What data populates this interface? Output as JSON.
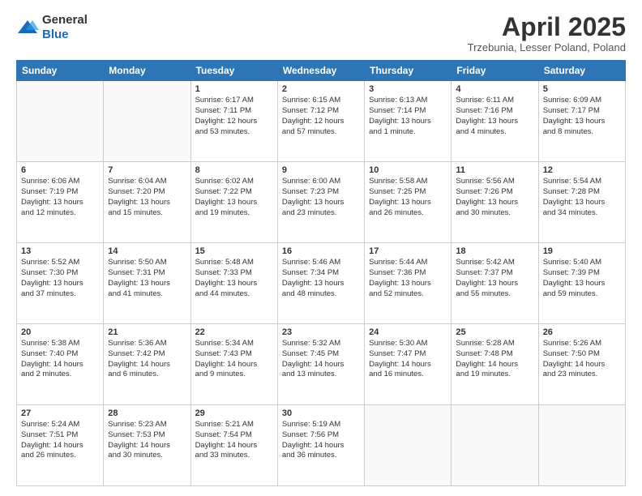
{
  "header": {
    "logo_general": "General",
    "logo_blue": "Blue",
    "month": "April 2025",
    "location": "Trzebunia, Lesser Poland, Poland"
  },
  "days_of_week": [
    "Sunday",
    "Monday",
    "Tuesday",
    "Wednesday",
    "Thursday",
    "Friday",
    "Saturday"
  ],
  "weeks": [
    [
      {
        "day": "",
        "info": ""
      },
      {
        "day": "",
        "info": ""
      },
      {
        "day": "1",
        "info": "Sunrise: 6:17 AM\nSunset: 7:11 PM\nDaylight: 12 hours\nand 53 minutes."
      },
      {
        "day": "2",
        "info": "Sunrise: 6:15 AM\nSunset: 7:12 PM\nDaylight: 12 hours\nand 57 minutes."
      },
      {
        "day": "3",
        "info": "Sunrise: 6:13 AM\nSunset: 7:14 PM\nDaylight: 13 hours\nand 1 minute."
      },
      {
        "day": "4",
        "info": "Sunrise: 6:11 AM\nSunset: 7:16 PM\nDaylight: 13 hours\nand 4 minutes."
      },
      {
        "day": "5",
        "info": "Sunrise: 6:09 AM\nSunset: 7:17 PM\nDaylight: 13 hours\nand 8 minutes."
      }
    ],
    [
      {
        "day": "6",
        "info": "Sunrise: 6:06 AM\nSunset: 7:19 PM\nDaylight: 13 hours\nand 12 minutes."
      },
      {
        "day": "7",
        "info": "Sunrise: 6:04 AM\nSunset: 7:20 PM\nDaylight: 13 hours\nand 15 minutes."
      },
      {
        "day": "8",
        "info": "Sunrise: 6:02 AM\nSunset: 7:22 PM\nDaylight: 13 hours\nand 19 minutes."
      },
      {
        "day": "9",
        "info": "Sunrise: 6:00 AM\nSunset: 7:23 PM\nDaylight: 13 hours\nand 23 minutes."
      },
      {
        "day": "10",
        "info": "Sunrise: 5:58 AM\nSunset: 7:25 PM\nDaylight: 13 hours\nand 26 minutes."
      },
      {
        "day": "11",
        "info": "Sunrise: 5:56 AM\nSunset: 7:26 PM\nDaylight: 13 hours\nand 30 minutes."
      },
      {
        "day": "12",
        "info": "Sunrise: 5:54 AM\nSunset: 7:28 PM\nDaylight: 13 hours\nand 34 minutes."
      }
    ],
    [
      {
        "day": "13",
        "info": "Sunrise: 5:52 AM\nSunset: 7:30 PM\nDaylight: 13 hours\nand 37 minutes."
      },
      {
        "day": "14",
        "info": "Sunrise: 5:50 AM\nSunset: 7:31 PM\nDaylight: 13 hours\nand 41 minutes."
      },
      {
        "day": "15",
        "info": "Sunrise: 5:48 AM\nSunset: 7:33 PM\nDaylight: 13 hours\nand 44 minutes."
      },
      {
        "day": "16",
        "info": "Sunrise: 5:46 AM\nSunset: 7:34 PM\nDaylight: 13 hours\nand 48 minutes."
      },
      {
        "day": "17",
        "info": "Sunrise: 5:44 AM\nSunset: 7:36 PM\nDaylight: 13 hours\nand 52 minutes."
      },
      {
        "day": "18",
        "info": "Sunrise: 5:42 AM\nSunset: 7:37 PM\nDaylight: 13 hours\nand 55 minutes."
      },
      {
        "day": "19",
        "info": "Sunrise: 5:40 AM\nSunset: 7:39 PM\nDaylight: 13 hours\nand 59 minutes."
      }
    ],
    [
      {
        "day": "20",
        "info": "Sunrise: 5:38 AM\nSunset: 7:40 PM\nDaylight: 14 hours\nand 2 minutes."
      },
      {
        "day": "21",
        "info": "Sunrise: 5:36 AM\nSunset: 7:42 PM\nDaylight: 14 hours\nand 6 minutes."
      },
      {
        "day": "22",
        "info": "Sunrise: 5:34 AM\nSunset: 7:43 PM\nDaylight: 14 hours\nand 9 minutes."
      },
      {
        "day": "23",
        "info": "Sunrise: 5:32 AM\nSunset: 7:45 PM\nDaylight: 14 hours\nand 13 minutes."
      },
      {
        "day": "24",
        "info": "Sunrise: 5:30 AM\nSunset: 7:47 PM\nDaylight: 14 hours\nand 16 minutes."
      },
      {
        "day": "25",
        "info": "Sunrise: 5:28 AM\nSunset: 7:48 PM\nDaylight: 14 hours\nand 19 minutes."
      },
      {
        "day": "26",
        "info": "Sunrise: 5:26 AM\nSunset: 7:50 PM\nDaylight: 14 hours\nand 23 minutes."
      }
    ],
    [
      {
        "day": "27",
        "info": "Sunrise: 5:24 AM\nSunset: 7:51 PM\nDaylight: 14 hours\nand 26 minutes."
      },
      {
        "day": "28",
        "info": "Sunrise: 5:23 AM\nSunset: 7:53 PM\nDaylight: 14 hours\nand 30 minutes."
      },
      {
        "day": "29",
        "info": "Sunrise: 5:21 AM\nSunset: 7:54 PM\nDaylight: 14 hours\nand 33 minutes."
      },
      {
        "day": "30",
        "info": "Sunrise: 5:19 AM\nSunset: 7:56 PM\nDaylight: 14 hours\nand 36 minutes."
      },
      {
        "day": "",
        "info": ""
      },
      {
        "day": "",
        "info": ""
      },
      {
        "day": "",
        "info": ""
      }
    ]
  ]
}
